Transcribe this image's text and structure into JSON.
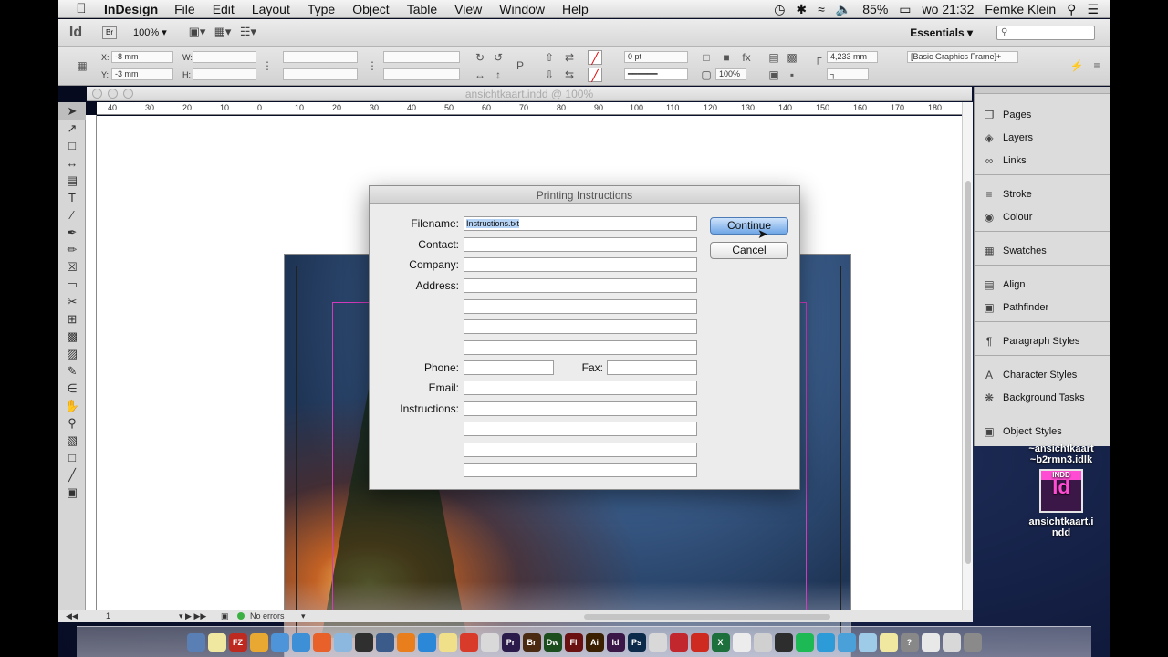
{
  "menubar": {
    "apple_icon": "apple-icon",
    "app_name": "InDesign",
    "items": [
      "File",
      "Edit",
      "Layout",
      "Type",
      "Object",
      "Table",
      "View",
      "Window",
      "Help"
    ],
    "battery": "85%",
    "clock": "wo 21:32",
    "user": "Femke Klein"
  },
  "appbar": {
    "logo": "Id",
    "bridge": "Br",
    "zoom": "100%",
    "workspace": "Essentials"
  },
  "control": {
    "x_label": "X:",
    "x_value": "-8 mm",
    "y_label": "Y:",
    "y_value": "-3 mm",
    "w_label": "W:",
    "h_label": "H:",
    "stroke_weight": "0 pt",
    "opacity": "100%",
    "frame_size": "4,233 mm",
    "object_style": "[Basic Graphics Frame]+"
  },
  "document": {
    "title": "ansichtkaart.indd @ 100%",
    "ruler_ticks": [
      "40",
      "30",
      "20",
      "10",
      "0",
      "10",
      "20",
      "30",
      "40",
      "50",
      "60",
      "70",
      "80",
      "90",
      "100",
      "110",
      "120",
      "130",
      "140",
      "150",
      "160",
      "170",
      "180"
    ],
    "page_number": "1",
    "preflight": "No errors"
  },
  "dialog": {
    "title": "Printing Instructions",
    "labels": {
      "filename": "Filename:",
      "contact": "Contact:",
      "company": "Company:",
      "address": "Address:",
      "phone": "Phone:",
      "fax": "Fax:",
      "email": "Email:",
      "instructions": "Instructions:"
    },
    "filename_value": "Instructions.txt",
    "continue_label": "Continue",
    "cancel_label": "Cancel"
  },
  "panels": [
    "Pages",
    "Layers",
    "Links",
    "Stroke",
    "Colour",
    "Swatches",
    "Align",
    "Pathfinder",
    "Paragraph Styles",
    "Character Styles",
    "Background Tasks",
    "Object Styles"
  ],
  "desktop": {
    "temp_file_line1": "~ansichtkaart",
    "temp_file_line2": "~b2rmn3.idlk",
    "file_badge": "INDD",
    "file_glyph": "Id",
    "file_line1": "ansichtkaart.i",
    "file_line2": "ndd"
  },
  "dock_apps": [
    {
      "label": "",
      "color": "#5a7fb5"
    },
    {
      "label": "",
      "color": "#f0e7a0"
    },
    {
      "label": "FZ",
      "color": "#bf2a20"
    },
    {
      "label": "",
      "color": "#e8a832"
    },
    {
      "label": "",
      "color": "#4d94d8"
    },
    {
      "label": "",
      "color": "#3d8fd6"
    },
    {
      "label": "",
      "color": "#e8602a"
    },
    {
      "label": "",
      "color": "#8cb8e0"
    },
    {
      "label": "",
      "color": "#2f2f2f"
    },
    {
      "label": "",
      "color": "#3b5b8a"
    },
    {
      "label": "",
      "color": "#e87f1c"
    },
    {
      "label": "",
      "color": "#2b88d8"
    },
    {
      "label": "",
      "color": "#f0e08a"
    },
    {
      "label": "",
      "color": "#d93b2b"
    },
    {
      "label": "",
      "color": "#d9d9d9"
    },
    {
      "label": "Pr",
      "color": "#2a1b4a"
    },
    {
      "label": "Br",
      "color": "#4a2a10"
    },
    {
      "label": "Dw",
      "color": "#1c4d1c"
    },
    {
      "label": "Fl",
      "color": "#6b1010"
    },
    {
      "label": "Ai",
      "color": "#3a2000"
    },
    {
      "label": "Id",
      "color": "#3a1747"
    },
    {
      "label": "Ps",
      "color": "#0c2a4a"
    },
    {
      "label": "",
      "color": "#d8d8d8"
    },
    {
      "label": "",
      "color": "#c1272d"
    },
    {
      "label": "",
      "color": "#cf2a1f"
    },
    {
      "label": "X",
      "color": "#1d6f3b"
    },
    {
      "label": "",
      "color": "#ececec"
    },
    {
      "label": "",
      "color": "#d0d0d0"
    },
    {
      "label": "",
      "color": "#2d2d2d"
    },
    {
      "label": "",
      "color": "#1db954"
    },
    {
      "label": "",
      "color": "#2d9bd8"
    },
    {
      "label": "",
      "color": "#4aa0d8"
    },
    {
      "label": "",
      "color": "#9ecbe8"
    },
    {
      "label": "",
      "color": "#f0e8a0"
    },
    {
      "label": "?",
      "color": "#888888"
    },
    {
      "label": "",
      "color": "#e8e8e8"
    },
    {
      "label": "",
      "color": "#d8d8d8"
    },
    {
      "label": "",
      "color": "#8a8a8a"
    }
  ]
}
